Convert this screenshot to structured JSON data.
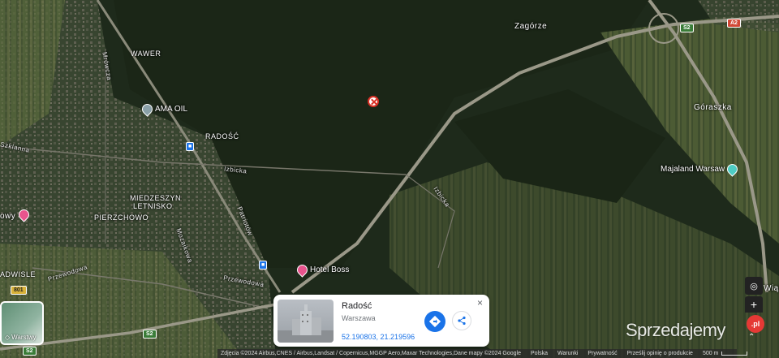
{
  "map": {
    "place_labels": {
      "zagorze": "Zagórze",
      "wawer": "WAWER",
      "radosc": "RADOŚĆ",
      "goraszka": "Góraszka",
      "miedzeszyn": "MIEDZESZYN",
      "letnisko": "LETNISKO",
      "pierzchowo": "PIERZCHOWO",
      "radwisle": "ADWISLE",
      "owy": "owy",
      "wiaz": "Wiąz"
    },
    "street_labels": {
      "mrowcza": "Mrówcza",
      "szklanna": "Szklanna",
      "izbicka": "Izbicka",
      "izbicka2": "Izbicka",
      "patriotow": "Patriotów",
      "mozaikowa": "Mozaikowa",
      "przewodowa": "Przewodowa",
      "przewodowa2": "Przewodowa"
    },
    "pois": {
      "ama_oil": "AMA OIL",
      "hotel_boss": "Hotel Boss",
      "majaland": "Majaland Warsaw"
    },
    "road_shields": {
      "a2": "A2",
      "s2_top": "S2",
      "s2_bottom": "S2",
      "s2_left": "S2",
      "r801": "801"
    }
  },
  "place_card": {
    "title": "Radość",
    "subtitle": "Warszawa",
    "coordinates": "52.190803, 21.219596",
    "close_label": "×"
  },
  "layers_button": {
    "label": "Warstwy"
  },
  "controls": {
    "zoom_in": "+",
    "zoom_out": "−"
  },
  "attribution": {
    "imagery": "Zdjęcia ©2024 Airbus,CNES / Airbus,Landsat / Copernicus,MGGP Aero,Maxar Technologies,Dane mapy ©2024 Google",
    "country": "Polska",
    "terms": "Warunki",
    "privacy": "Prywatność",
    "feedback": "Prześlij opinię o produkcie",
    "scale": "500 m"
  },
  "watermark": {
    "text": "Sprzedajemy",
    "badge": ".pl"
  },
  "colors": {
    "accent": "#1a73e8",
    "poi_pin": "#e8548d",
    "poi_teal": "#4ecdc4",
    "marker": "#d93025",
    "shield": "#3a7c38",
    "shield_a": "#d14836"
  }
}
